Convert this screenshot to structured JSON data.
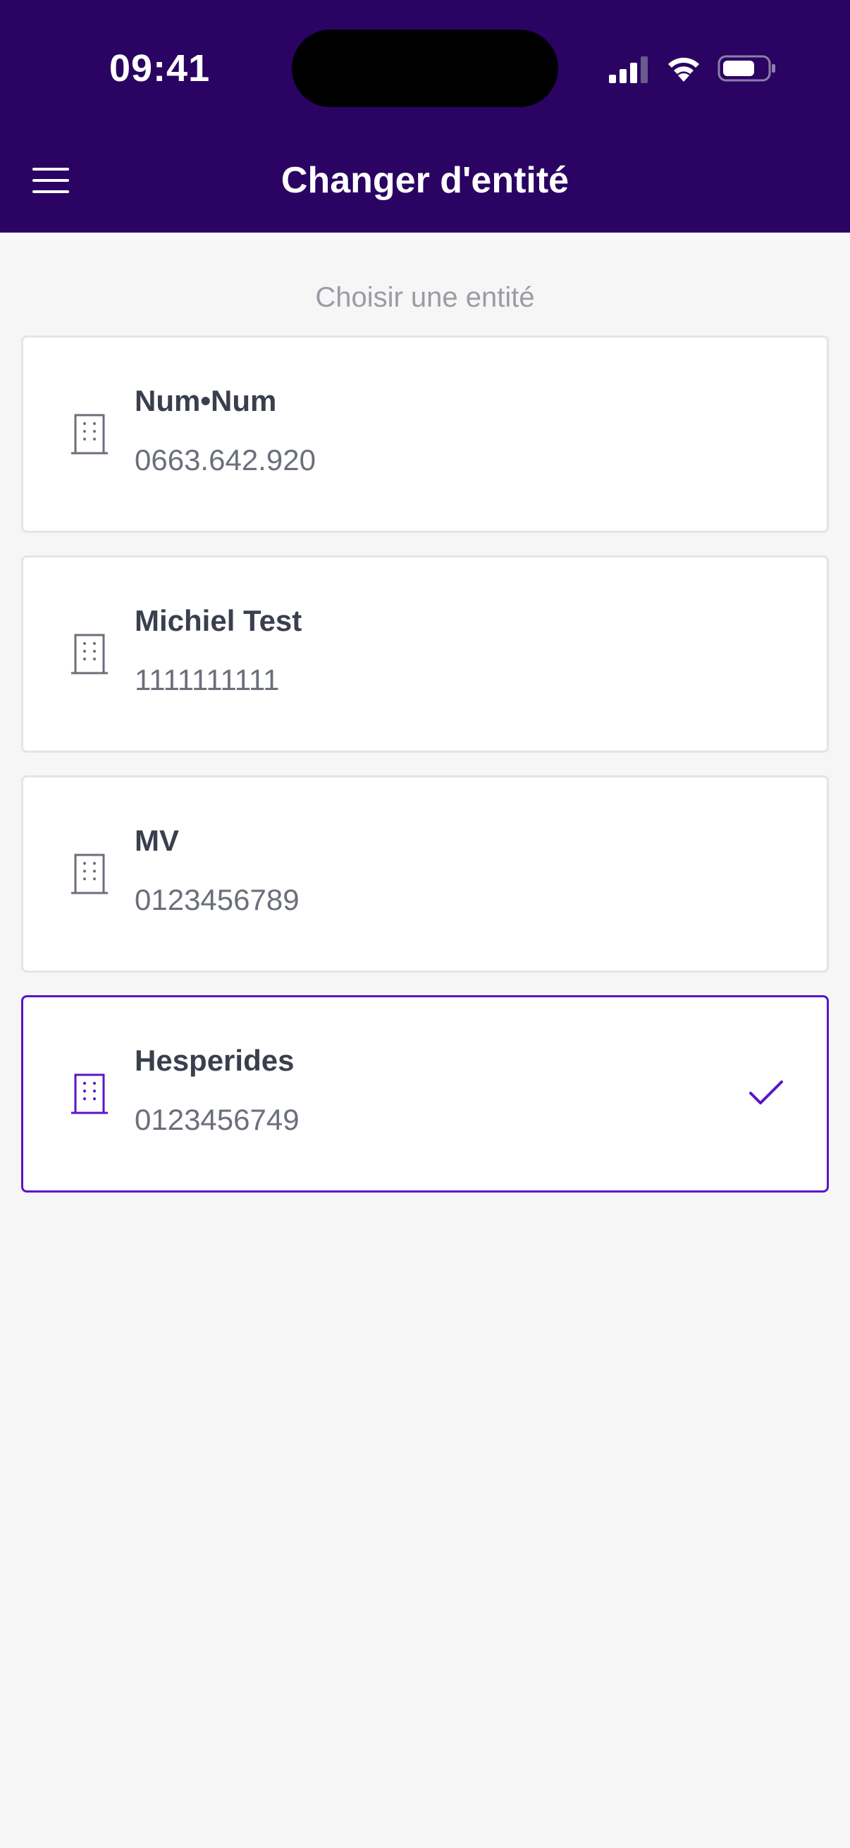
{
  "status_bar": {
    "time": "09:41"
  },
  "header": {
    "title": "Changer d'entité",
    "menu_icon": "hamburger-menu-icon"
  },
  "section_label": "Choisir une entité",
  "entities": [
    {
      "name": "Num•Num",
      "number": "0663.642.920",
      "selected": false,
      "icon": "building-icon"
    },
    {
      "name": "Michiel Test",
      "number": "1111111111",
      "selected": false,
      "icon": "building-icon"
    },
    {
      "name": "MV",
      "number": "0123456789",
      "selected": false,
      "icon": "building-icon"
    },
    {
      "name": "Hesperides",
      "number": "0123456749",
      "selected": true,
      "icon": "building-icon"
    }
  ],
  "colors": {
    "header_bg": "#2a0363",
    "accent": "#5b14c8",
    "page_bg": "#f6f6f7",
    "text_primary": "#3a3f4e",
    "text_secondary": "#6b6f7a",
    "icon_default": "#6b6f7a"
  }
}
